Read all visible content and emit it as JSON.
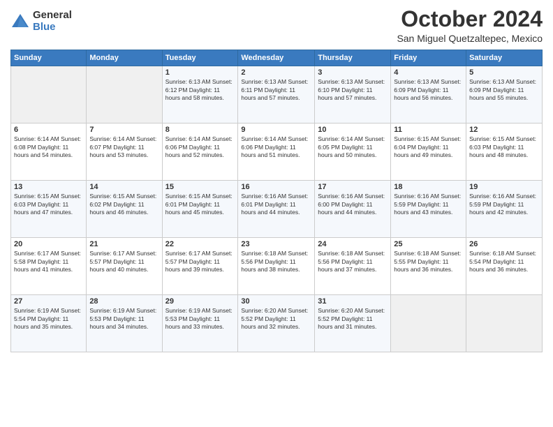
{
  "logo": {
    "general": "General",
    "blue": "Blue"
  },
  "header": {
    "month": "October 2024",
    "location": "San Miguel Quetzaltepec, Mexico"
  },
  "days_of_week": [
    "Sunday",
    "Monday",
    "Tuesday",
    "Wednesday",
    "Thursday",
    "Friday",
    "Saturday"
  ],
  "weeks": [
    [
      {
        "day": "",
        "info": ""
      },
      {
        "day": "",
        "info": ""
      },
      {
        "day": "1",
        "info": "Sunrise: 6:13 AM\nSunset: 6:12 PM\nDaylight: 11 hours and 58 minutes."
      },
      {
        "day": "2",
        "info": "Sunrise: 6:13 AM\nSunset: 6:11 PM\nDaylight: 11 hours and 57 minutes."
      },
      {
        "day": "3",
        "info": "Sunrise: 6:13 AM\nSunset: 6:10 PM\nDaylight: 11 hours and 57 minutes."
      },
      {
        "day": "4",
        "info": "Sunrise: 6:13 AM\nSunset: 6:09 PM\nDaylight: 11 hours and 56 minutes."
      },
      {
        "day": "5",
        "info": "Sunrise: 6:13 AM\nSunset: 6:09 PM\nDaylight: 11 hours and 55 minutes."
      }
    ],
    [
      {
        "day": "6",
        "info": "Sunrise: 6:14 AM\nSunset: 6:08 PM\nDaylight: 11 hours and 54 minutes."
      },
      {
        "day": "7",
        "info": "Sunrise: 6:14 AM\nSunset: 6:07 PM\nDaylight: 11 hours and 53 minutes."
      },
      {
        "day": "8",
        "info": "Sunrise: 6:14 AM\nSunset: 6:06 PM\nDaylight: 11 hours and 52 minutes."
      },
      {
        "day": "9",
        "info": "Sunrise: 6:14 AM\nSunset: 6:06 PM\nDaylight: 11 hours and 51 minutes."
      },
      {
        "day": "10",
        "info": "Sunrise: 6:14 AM\nSunset: 6:05 PM\nDaylight: 11 hours and 50 minutes."
      },
      {
        "day": "11",
        "info": "Sunrise: 6:15 AM\nSunset: 6:04 PM\nDaylight: 11 hours and 49 minutes."
      },
      {
        "day": "12",
        "info": "Sunrise: 6:15 AM\nSunset: 6:03 PM\nDaylight: 11 hours and 48 minutes."
      }
    ],
    [
      {
        "day": "13",
        "info": "Sunrise: 6:15 AM\nSunset: 6:03 PM\nDaylight: 11 hours and 47 minutes."
      },
      {
        "day": "14",
        "info": "Sunrise: 6:15 AM\nSunset: 6:02 PM\nDaylight: 11 hours and 46 minutes."
      },
      {
        "day": "15",
        "info": "Sunrise: 6:15 AM\nSunset: 6:01 PM\nDaylight: 11 hours and 45 minutes."
      },
      {
        "day": "16",
        "info": "Sunrise: 6:16 AM\nSunset: 6:01 PM\nDaylight: 11 hours and 44 minutes."
      },
      {
        "day": "17",
        "info": "Sunrise: 6:16 AM\nSunset: 6:00 PM\nDaylight: 11 hours and 44 minutes."
      },
      {
        "day": "18",
        "info": "Sunrise: 6:16 AM\nSunset: 5:59 PM\nDaylight: 11 hours and 43 minutes."
      },
      {
        "day": "19",
        "info": "Sunrise: 6:16 AM\nSunset: 5:59 PM\nDaylight: 11 hours and 42 minutes."
      }
    ],
    [
      {
        "day": "20",
        "info": "Sunrise: 6:17 AM\nSunset: 5:58 PM\nDaylight: 11 hours and 41 minutes."
      },
      {
        "day": "21",
        "info": "Sunrise: 6:17 AM\nSunset: 5:57 PM\nDaylight: 11 hours and 40 minutes."
      },
      {
        "day": "22",
        "info": "Sunrise: 6:17 AM\nSunset: 5:57 PM\nDaylight: 11 hours and 39 minutes."
      },
      {
        "day": "23",
        "info": "Sunrise: 6:18 AM\nSunset: 5:56 PM\nDaylight: 11 hours and 38 minutes."
      },
      {
        "day": "24",
        "info": "Sunrise: 6:18 AM\nSunset: 5:56 PM\nDaylight: 11 hours and 37 minutes."
      },
      {
        "day": "25",
        "info": "Sunrise: 6:18 AM\nSunset: 5:55 PM\nDaylight: 11 hours and 36 minutes."
      },
      {
        "day": "26",
        "info": "Sunrise: 6:18 AM\nSunset: 5:54 PM\nDaylight: 11 hours and 36 minutes."
      }
    ],
    [
      {
        "day": "27",
        "info": "Sunrise: 6:19 AM\nSunset: 5:54 PM\nDaylight: 11 hours and 35 minutes."
      },
      {
        "day": "28",
        "info": "Sunrise: 6:19 AM\nSunset: 5:53 PM\nDaylight: 11 hours and 34 minutes."
      },
      {
        "day": "29",
        "info": "Sunrise: 6:19 AM\nSunset: 5:53 PM\nDaylight: 11 hours and 33 minutes."
      },
      {
        "day": "30",
        "info": "Sunrise: 6:20 AM\nSunset: 5:52 PM\nDaylight: 11 hours and 32 minutes."
      },
      {
        "day": "31",
        "info": "Sunrise: 6:20 AM\nSunset: 5:52 PM\nDaylight: 11 hours and 31 minutes."
      },
      {
        "day": "",
        "info": ""
      },
      {
        "day": "",
        "info": ""
      }
    ]
  ]
}
